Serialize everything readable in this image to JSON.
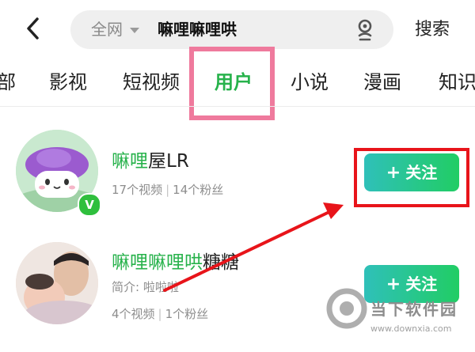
{
  "search": {
    "scope": "全网",
    "query": "嘛哩嘛哩哄",
    "submit_label": "搜索"
  },
  "tabs": [
    {
      "label": "部",
      "active": false
    },
    {
      "label": "影视",
      "active": false
    },
    {
      "label": "短视频",
      "active": false
    },
    {
      "label": "用户",
      "active": true
    },
    {
      "label": "小说",
      "active": false
    },
    {
      "label": "漫画",
      "active": false
    },
    {
      "label": "知识",
      "active": false
    }
  ],
  "results": [
    {
      "name_highlight": "嘛哩",
      "name_rest": "屋LR",
      "stats_videos": "17个视频",
      "stats_fans": "14个粉丝",
      "intro": "",
      "verified": true,
      "follow_label": "关注"
    },
    {
      "name_highlight": "嘛哩嘛哩哄",
      "name_rest": "糖糖",
      "stats_videos": "4个视频",
      "stats_fans": "1个粉丝",
      "intro": "简介: 啦啦啦",
      "verified": false,
      "follow_label": "关注"
    }
  ],
  "watermark": {
    "text": "当下软件园",
    "url": "www.downxia.com"
  },
  "colors": {
    "accent_green": "#27b24b",
    "highlight_pink": "#ef7a9d",
    "annotation_red": "#e8141a"
  }
}
